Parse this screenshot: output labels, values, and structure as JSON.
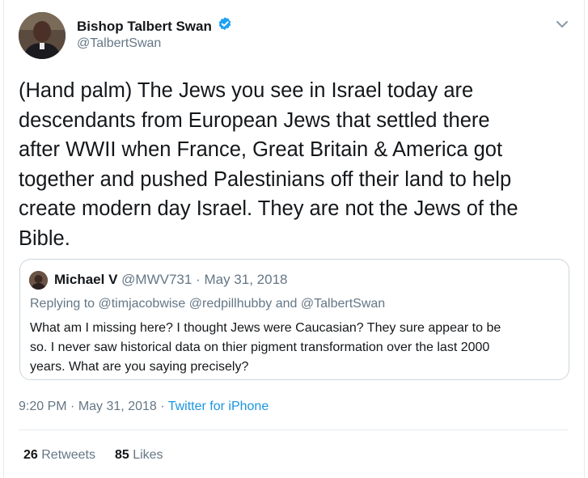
{
  "author": {
    "name": "Bishop Talbert Swan",
    "handle": "@TalbertSwan",
    "verified": true
  },
  "tweet": {
    "lines": [
      "(Hand palm) The Jews you see in Israel today are",
      "descendants from European Jews that settled there",
      "after WWII when France, Great Britain & America got",
      "together and pushed Palestinians off their land to help",
      "create modern day Israel. They are not the Jews of the",
      "Bible."
    ]
  },
  "quoted_tweet": {
    "name": "Michael V",
    "handle": "@MWV731",
    "separator": "·",
    "date": "May 31, 2018",
    "replying_to": "Replying to @timjacobwise @redpillhubby and @TalbertSwan",
    "lines": [
      "What am I missing here? I thought Jews were Caucasian?  They sure appear to be",
      "so. I never saw historical data on thier pigment transformation over the last 2000",
      "years. What are you saying precisely?"
    ]
  },
  "meta": {
    "time": "9:20 PM",
    "date": "May 31, 2018",
    "separator": "·",
    "source": "Twitter for iPhone"
  },
  "stats": {
    "retweets_count": "26",
    "retweets_label": "Retweets",
    "likes_count": "85",
    "likes_label": "Likes"
  },
  "colors": {
    "text": "#14171a",
    "secondary": "#657786",
    "link": "#1b95e0",
    "verified": "#1da1f2",
    "border": "#ccd6dd"
  },
  "icons": {
    "verified": "verified-badge-icon",
    "menu": "chevron-down-icon"
  }
}
